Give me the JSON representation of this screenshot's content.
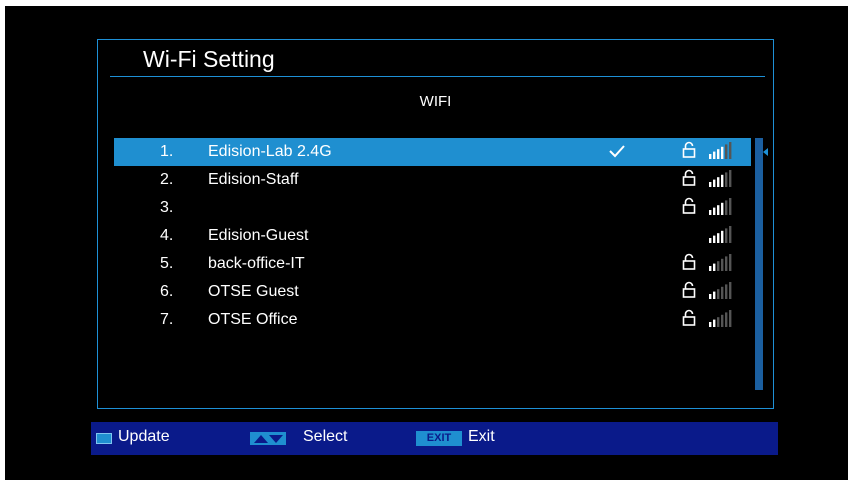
{
  "window": {
    "title": "Wi-Fi Setting"
  },
  "list_heading": "WIFI",
  "networks": [
    {
      "index": "1.",
      "ssid": "Edision-Lab 2.4G",
      "connected": true,
      "locked": true,
      "signal_bars": 4
    },
    {
      "index": "2.",
      "ssid": "Edision-Staff",
      "connected": false,
      "locked": true,
      "signal_bars": 4
    },
    {
      "index": "3.",
      "ssid": "",
      "connected": false,
      "locked": true,
      "signal_bars": 4
    },
    {
      "index": "4.",
      "ssid": "Edision-Guest",
      "connected": false,
      "locked": false,
      "signal_bars": 4
    },
    {
      "index": "5.",
      "ssid": "back-office-IT",
      "connected": false,
      "locked": true,
      "signal_bars": 2
    },
    {
      "index": "6.",
      "ssid": "OTSE Guest",
      "connected": false,
      "locked": true,
      "signal_bars": 2
    },
    {
      "index": "7.",
      "ssid": "OTSE Office",
      "connected": false,
      "locked": true,
      "signal_bars": 2
    }
  ],
  "selected_index": 0,
  "footer": {
    "update_label": "Update",
    "select_label": "Select",
    "exit_key_label": "EXIT",
    "exit_label": "Exit"
  },
  "colors": {
    "accent": "#1f8fd0",
    "footer_bg": "#0a1a8a",
    "background": "#000000"
  }
}
